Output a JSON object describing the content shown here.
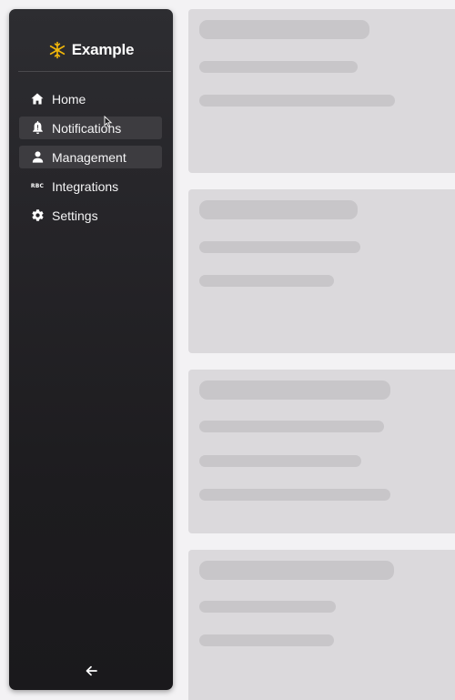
{
  "brand": {
    "name": "Example",
    "logo_color": "#f2b70a"
  },
  "nav": {
    "items": [
      {
        "label": "Home",
        "icon": "home-icon",
        "highlighted": false
      },
      {
        "label": "Notifications",
        "icon": "bell-icon",
        "highlighted": true
      },
      {
        "label": "Management",
        "icon": "person-icon",
        "highlighted": true
      },
      {
        "label": "Integrations",
        "icon": "abc-icon",
        "icon_text": "RBC",
        "highlighted": false
      },
      {
        "label": "Settings",
        "icon": "gear-icon",
        "highlighted": false
      }
    ]
  },
  "collapse": {
    "icon": "arrow-left-icon"
  },
  "content": {
    "state": "loading-skeleton",
    "cards": 4
  },
  "colors": {
    "sidebar_bg": "#262529",
    "highlight_bg": "#3d3c40",
    "skeleton_card": "#dbd9dc",
    "skeleton_bar": "#c8c6c9",
    "page_bg": "#f3f2f4"
  }
}
